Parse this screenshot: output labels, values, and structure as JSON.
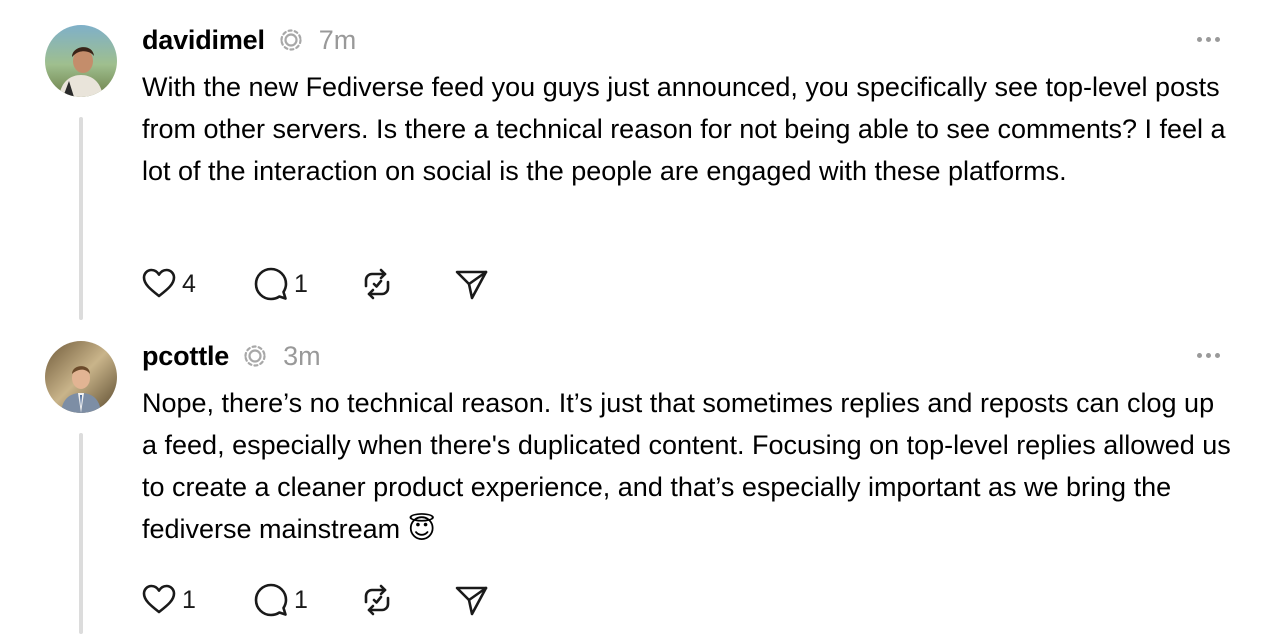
{
  "posts": [
    {
      "username": "davidimel",
      "time": "7m",
      "text": "With the new Fediverse feed you guys just announced, you specifically see top-level posts from other servers. Is there a technical reason for not being able to see comments? I feel a lot of the interaction on social is the people are engaged with these platforms.",
      "likes": "4",
      "replies": "1"
    },
    {
      "username": "pcottle",
      "time": "3m",
      "text": "Nope, there’s no technical reason. It’s just that sometimes replies and reposts can clog up a feed, especially when there's duplicated content. Focusing on top-level replies allowed us to create a cleaner product experience, and that’s especially important as we bring the fediverse mainstream 😇",
      "likes": "1",
      "replies": "1"
    }
  ],
  "icons": {
    "fediverse": "fediverse-icon",
    "like": "heart-icon",
    "reply": "comment-icon",
    "repost": "repost-icon",
    "share": "send-icon",
    "more": "more-horizontal-icon"
  },
  "colors": {
    "text": "#000000",
    "muted": "#999999",
    "thread_line": "#dcdcdc",
    "icon": "#1a1a1a"
  }
}
